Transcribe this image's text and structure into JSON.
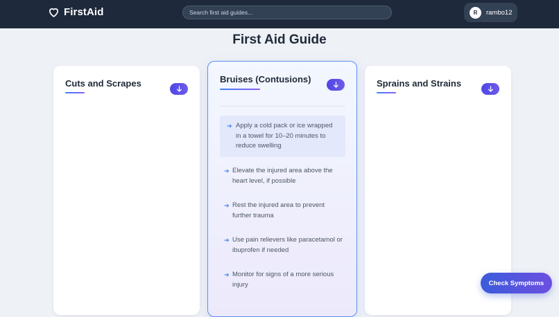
{
  "header": {
    "brand_name": "FirstAid",
    "search_placeholder": "Search first aid guides...",
    "user": {
      "initial": "R",
      "name": "rambo12"
    }
  },
  "main": {
    "title": "First Aid Guide",
    "cards": [
      {
        "title": "Cuts and Scrapes",
        "expanded": false
      },
      {
        "title": "Bruises (Contusions)",
        "expanded": true,
        "tips": [
          "Apply a cold pack or ice wrapped in a towel for 10–20 minutes to reduce swelling",
          "Elevate the injured area above the heart level, if possible",
          "Rest the injured area to prevent further trauma",
          "Use pain relievers like paracetamol or ibuprofen if needed",
          "Monitor for signs of a more serious injury"
        ]
      },
      {
        "title": "Sprains and Strains",
        "expanded": false
      }
    ]
  },
  "fab": {
    "label": "Check Symptoms"
  },
  "colors": {
    "header_bg": "#1e293b",
    "accent": "#3b82f6",
    "accent_secondary": "#8b5cf6"
  }
}
